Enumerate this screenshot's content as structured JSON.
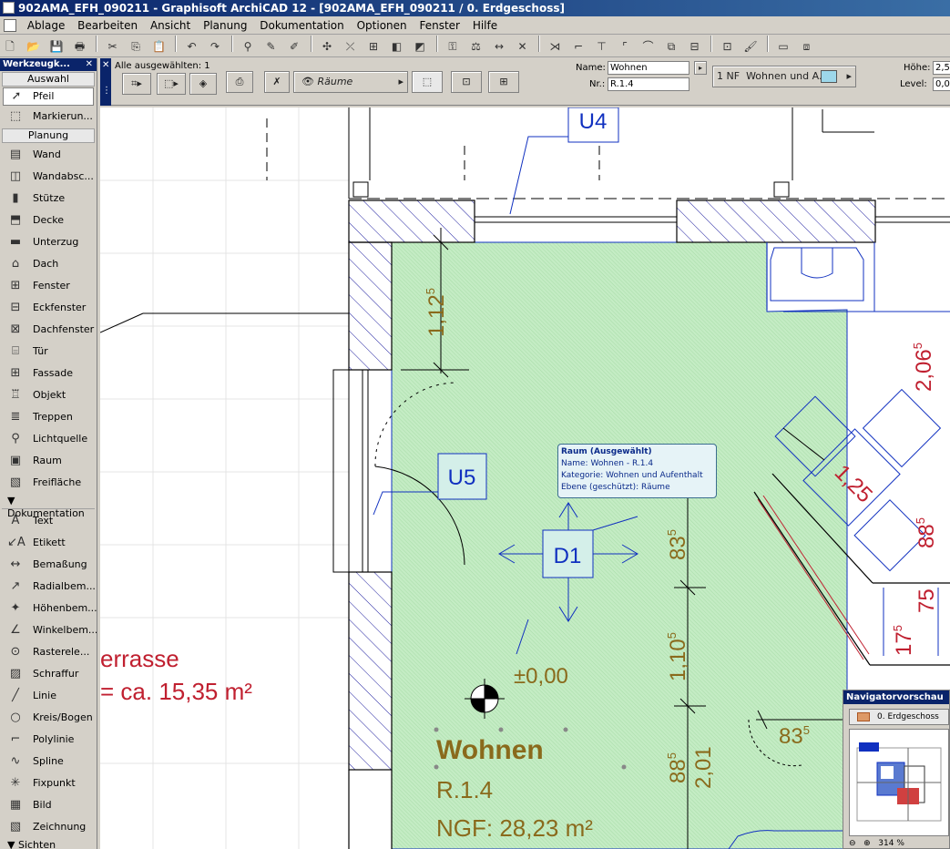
{
  "window": {
    "title": "902AMA_EFH_090211 - Graphisoft ArchiCAD 12 - [902AMA_EFH_090211 / 0. Erdgeschoss]"
  },
  "menu": [
    "Ablage",
    "Bearbeiten",
    "Ansicht",
    "Planung",
    "Dokumentation",
    "Optionen",
    "Fenster",
    "Hilfe"
  ],
  "infobox": {
    "selection": "Alle ausgewählten: 1",
    "layer_label": "Räume",
    "name_label": "Name:",
    "name_value": "Wohnen",
    "nr_label": "Nr.:",
    "nr_value": "R.1.4",
    "story_value": "1 NF",
    "category_value": "Wohnen und A...",
    "hoehe_label": "Höhe:",
    "hoehe_value": "2,5",
    "level_label": "Level:",
    "level_value": "0,0"
  },
  "toolbox": {
    "title": "Werkzeugk...",
    "sections": {
      "auswahl": "Auswahl",
      "planung": "Planung",
      "dokumentation": "Dokumentation",
      "sichten": "Sichten"
    },
    "select_tools": [
      "Pfeil",
      "Markierun..."
    ],
    "planung_tools": [
      "Wand",
      "Wandabsc...",
      "Stütze",
      "Decke",
      "Unterzug",
      "Dach",
      "Fenster",
      "Eckfenster",
      "Dachfenster",
      "Tür",
      "Fassade",
      "Objekt",
      "Treppen",
      "Lichtquelle",
      "Raum",
      "Freifläche"
    ],
    "doku_tools": [
      "Text",
      "Etikett",
      "Bemaßung",
      "Radialbem...",
      "Höhenbem...",
      "Winkelbem...",
      "Rasterele...",
      "Schraffur",
      "Linie",
      "Kreis/Bogen",
      "Polylinie",
      "Spline",
      "Fixpunkt",
      "Bild",
      "Zeichnung"
    ]
  },
  "drawing": {
    "marker_u4": "U4",
    "marker_u5": "U5",
    "marker_d1": "D1",
    "dim_112": "1,12",
    "dim_112_sup": "5",
    "dim_206": "2,06",
    "dim_206_sup": "5",
    "dim_125": "1,25",
    "dim_88": "88",
    "dim_88_sup": "5",
    "dim_75": "75",
    "dim_17": "17",
    "dim_17_sup": "5",
    "dim_83a": "83",
    "dim_83a_sup": "5",
    "dim_110": "1,10",
    "dim_110_sup": "5",
    "dim_885": "88",
    "dim_885_sup": "5",
    "dim_201": "2,01",
    "dim_83b": "83",
    "dim_83b_sup": "5",
    "level": "±0,00",
    "room_name": "Wohnen",
    "room_nr": "R.1.4",
    "room_area": "NGF: 28,23 m²",
    "terrace": "errasse",
    "terrace_area": "= ca. 15,35 m²"
  },
  "tooltip": {
    "title": "Raum (Ausgewählt)",
    "name": "Name: Wohnen - R.1.4",
    "category": "Kategorie: Wohnen und Aufenthalt",
    "layer": "Ebene (geschützt): Räume"
  },
  "navigator": {
    "title": "Navigatorvorschau",
    "story": "0. Erdgeschoss",
    "zoom": "314 %"
  },
  "colors": {
    "room_fill": "#c4ecc4",
    "dim_text": "#8a6a1c",
    "red_dim": "#c02030",
    "blue": "#1030c0",
    "titlebar": "#0a246a"
  }
}
